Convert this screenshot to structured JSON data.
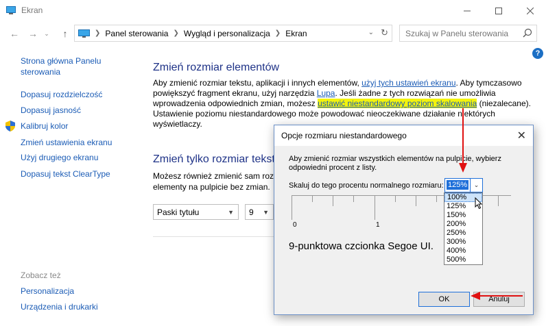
{
  "window": {
    "title": "Ekran"
  },
  "address": {
    "crumbs": [
      "Panel sterowania",
      "Wygląd i personalizacja",
      "Ekran"
    ],
    "search_placeholder": "Szukaj w Panelu sterowania"
  },
  "help": {
    "label": "?"
  },
  "sidebar": {
    "items": [
      {
        "label": "Strona główna Panelu"
      },
      {
        "label": "sterowania"
      },
      {
        "label": "Dopasuj rozdzielczość"
      },
      {
        "label": "Dopasuj jasność"
      },
      {
        "label": "Kalibruj kolor"
      },
      {
        "label": "Zmień ustawienia ekranu"
      },
      {
        "label": "Użyj drugiego ekranu"
      },
      {
        "label": "Dopasuj tekst ClearType"
      }
    ],
    "see_also": "Zobacz też",
    "see_also_items": [
      {
        "label": "Personalizacja"
      },
      {
        "label": "Urządzenia i drukarki"
      }
    ]
  },
  "main": {
    "heading1": "Zmień rozmiar elementów",
    "para1": {
      "t1": "Aby zmienić rozmiar tekstu, aplikacji i innych elementów, ",
      "link1": "użyj tych ustawień ekranu",
      "t2": ". Aby tymczasowo powiększyć fragment ekranu, użyj narzędzia ",
      "link2": "Lupa",
      "t3": ". Jeśli żadne z tych rozwiązań nie umożliwia wprowadzenia odpowiednich zmian, możesz ",
      "link3": "ustawić niestandardowy poziom skalowania",
      "t4": " (niezalecane). Ustawienie poziomu niestandardowego może powodować nieoczekiwane działanie niektórych wyświetlaczy."
    },
    "heading2": "Zmień tylko rozmiar tekstu",
    "para2_line1": "Możesz również zmienić sam rozm",
    "para2_line2": "elementy na pulpicie bez zmian.",
    "element_select": "Paski tytułu",
    "size_select": "9"
  },
  "dialog": {
    "title": "Opcje rozmiaru niestandardowego",
    "text": "Aby zmienić rozmiar wszystkich elementów na pulpicie, wybierz odpowiedni procent z listy.",
    "scale_label": "Skaluj do tego procentu normalnego rozmiaru:",
    "scale_value": "125%",
    "options": [
      "100%",
      "125%",
      "150%",
      "200%",
      "250%",
      "300%",
      "400%",
      "500%"
    ],
    "highlighted_option": "100%",
    "ruler_labels": [
      "0",
      "1"
    ],
    "sample_text": "9-punktowa czcionka Segoe UI.",
    "ok": "OK",
    "cancel": "Anuluj"
  },
  "colors": {
    "link": "#1a5bb5",
    "heading": "#1e3287",
    "highlight": "#f4f40c",
    "accent": "#1e6fd9",
    "arrow": "#e01010"
  }
}
